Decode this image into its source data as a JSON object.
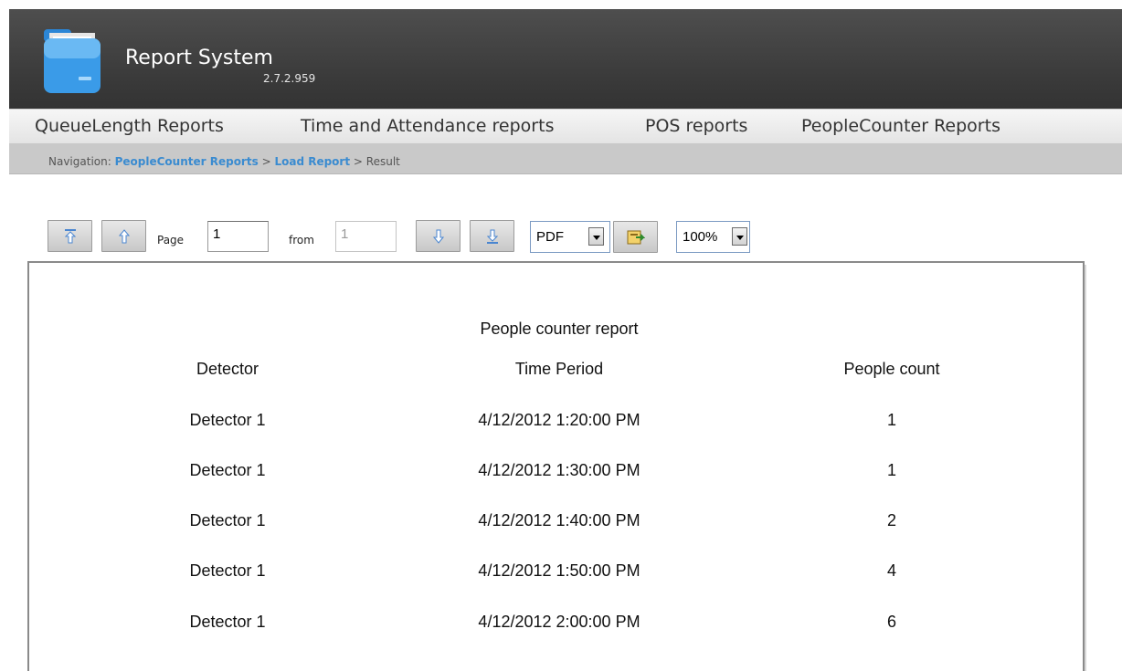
{
  "app": {
    "title": "Report System",
    "version": "2.7.2.959",
    "logo_icon": "folder-icon"
  },
  "menu": {
    "items": [
      "QueueLength Reports",
      "Time and Attendance reports",
      "POS reports",
      "PeopleCounter Reports"
    ]
  },
  "breadcrumb": {
    "prefix": "Navigation:",
    "items": [
      {
        "label": "PeopleCounter Reports",
        "link": true
      },
      {
        "label": "Load Report",
        "link": true
      },
      {
        "label": "Result",
        "link": false
      }
    ],
    "separator": ">"
  },
  "toolbar": {
    "first_page_icon": "first-page-icon",
    "prev_page_icon": "previous-page-icon",
    "page_label": "Page",
    "page_value": "1",
    "from_label": "from",
    "total_pages": "1",
    "next_page_icon": "next-page-icon",
    "last_page_icon": "last-page-icon",
    "export_format": "PDF",
    "export_icon": "export-icon",
    "zoom": "100%"
  },
  "report": {
    "title": "People counter report",
    "columns": [
      "Detector",
      "Time Period",
      "People count"
    ],
    "rows": [
      [
        "Detector 1",
        "4/12/2012 1:20:00 PM",
        "1"
      ],
      [
        "Detector 1",
        "4/12/2012 1:30:00 PM",
        "1"
      ],
      [
        "Detector 1",
        "4/12/2012 1:40:00 PM",
        "2"
      ],
      [
        "Detector 1",
        "4/12/2012 1:50:00 PM",
        "4"
      ],
      [
        "Detector 1",
        "4/12/2012 2:00:00 PM",
        "6"
      ]
    ]
  },
  "colors": {
    "header_bg": "#3f3f3f",
    "link": "#3a8bd0",
    "nav_bg": "#c9c9c9",
    "arrow_icon": "#4a86d0"
  }
}
